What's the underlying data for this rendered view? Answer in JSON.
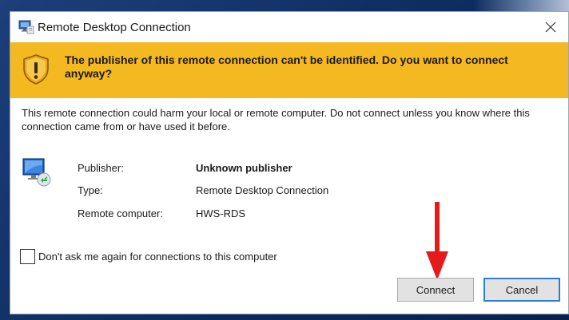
{
  "window": {
    "title": "Remote Desktop Connection",
    "close_icon": "close-icon"
  },
  "warning": {
    "icon": "shield-warning-icon",
    "text": "The publisher of this remote connection can't be identified. Do you want to connect anyway?",
    "color": "#f4b921"
  },
  "description": "This remote connection could harm your local or remote computer. Do not connect unless you know where this connection came from or have used it before.",
  "details": {
    "icon": "remote-desktop-monitor-icon",
    "rows": [
      {
        "label": "Publisher:",
        "value": "Unknown publisher"
      },
      {
        "label": "Type:",
        "value": "Remote Desktop Connection"
      },
      {
        "label": "Remote computer:",
        "value": "HWS-RDS"
      }
    ]
  },
  "checkbox": {
    "label": "Don't ask me again for connections to this computer",
    "checked": false
  },
  "buttons": {
    "connect": "Connect",
    "cancel": "Cancel"
  },
  "annotation": {
    "type": "red-arrow-icon",
    "color": "#e31b1b"
  }
}
